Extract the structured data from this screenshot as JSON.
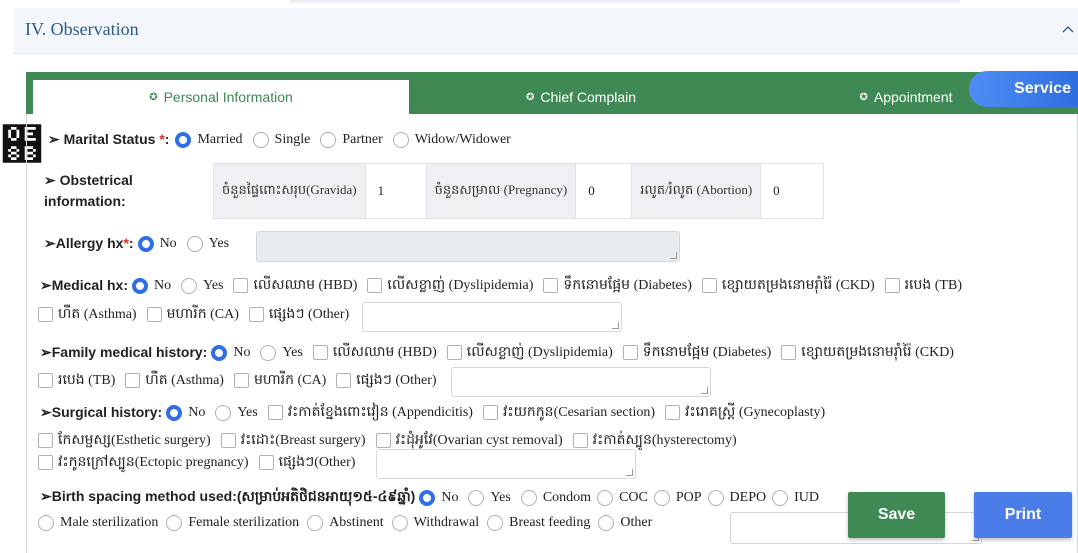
{
  "section": {
    "title": "IV. Observation"
  },
  "left_glyph": "຋",
  "tabs": [
    {
      "label": "Personal Information",
      "icon": "circle-icon"
    },
    {
      "label": "Chief Complain",
      "icon": "circle-icon"
    },
    {
      "label": "Appointment",
      "icon": "circle-icon"
    }
  ],
  "service_button": "Service",
  "marital": {
    "label": "Marital Status ",
    "required": "*",
    "colon": ":",
    "options": [
      "Married",
      "Single",
      "Partner",
      "Widow/Widower"
    ],
    "selected": "Married"
  },
  "obstetrical": {
    "label_line1": "Obstetrical",
    "label_line2": "information:",
    "fields": [
      {
        "name": "ចំនួនផ្ទៃពោះសរុប(Gravida)",
        "value": "1"
      },
      {
        "name": "ចំនួនសម្រាល (Pregnancy)",
        "value": "0"
      },
      {
        "name": "រលូត/រំលូត (Abortion)",
        "value": "0"
      }
    ]
  },
  "allergy": {
    "label": "Allergy hx",
    "required": "*",
    "colon": ":",
    "options": [
      "No",
      "Yes"
    ],
    "selected": "No"
  },
  "medical": {
    "label": "Medical hx:",
    "radios": [
      "No",
      "Yes"
    ],
    "selected": "No",
    "checks_line1": [
      "លើសឈាម (HBD)",
      "លើសខ្លាញ់ (Dyslipidemia)",
      "ទឹកនោមផ្អែម (Diabetes)",
      "ខ្សោយតម្រងនោមរ៉ាំរ៉ៃ (CKD)",
      "របេង (TB)"
    ],
    "checks_line2": [
      "ហឺត (Asthma)",
      "មហារីក (CA)",
      "ផ្សេងៗ (Other)"
    ]
  },
  "family": {
    "label": "Family medical history:",
    "radios": [
      "No",
      "Yes"
    ],
    "selected": "No",
    "checks_line1": [
      "លើសឈាម (HBD)",
      "លើសខ្លាញ់ (Dyslipidemia)",
      "ទឹកនោមផ្អែម (Diabetes)",
      "ខ្សោយតម្រងនោមរ៉ាំរ៉ៃ (CKD)"
    ],
    "checks_line2": [
      "របេង (TB)",
      "ហឺត (Asthma)",
      "មហារីក (CA)",
      "ផ្សេងៗ (Other)"
    ]
  },
  "surgical": {
    "label": "Surgical history:",
    "radios": [
      "No",
      "Yes"
    ],
    "selected": "No",
    "checks_line1": [
      "វះកាត់ខ្នែងពោះវៀន (Appendicitis)",
      "វះយកកូន(Cesarian section)",
      "វះរោគស្ត្រី (Gynecoplasty)"
    ],
    "checks_line2": [
      "កែសម្ផស្ស(Esthetic surgery)",
      "វះដោះ(Breast surgery)",
      "វះដុំអូវែ(Ovarian cyst removal)",
      "វះកាត់ស្បូន(hysterectomy)"
    ],
    "checks_line3": [
      "វះកូនក្រៅស្បូន(Ectopic pregnancy)",
      "ផ្សេងៗ(Other)"
    ]
  },
  "birth": {
    "label": "Birth spacing method used:(សម្រាប់អតិថិជនអាយុ១៥-៤៩ឆ្នាំ)",
    "radios_line1": [
      "No",
      "Yes",
      "Condom",
      "COC",
      "POP",
      "DEPO",
      "IUD"
    ],
    "selected": "No",
    "radios_line2": [
      "Male sterilization",
      "Female sterilization",
      "Abstinent",
      "Withdrawal",
      "Breast feeding",
      "Other"
    ]
  },
  "buttons": {
    "save": "Save",
    "print": "Print"
  },
  "colors": {
    "green": "#3f8a54",
    "blue": "#4b7de8",
    "radio_on": "#2f6ee4",
    "required": "#d9302b"
  }
}
